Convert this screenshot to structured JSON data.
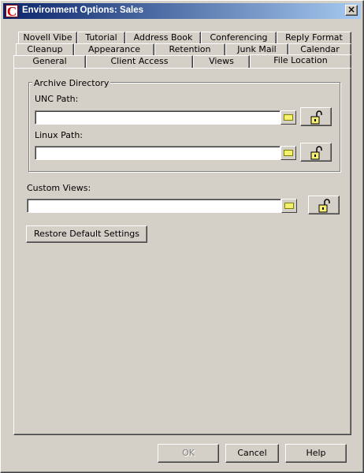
{
  "window": {
    "title": "Environment Options:  Sales",
    "icon_letter": "C",
    "close_label": "×"
  },
  "tabs": {
    "row1": [
      "Novell Vibe",
      "Tutorial",
      "Address Book",
      "Conferencing",
      "Reply Format"
    ],
    "row2": [
      "Cleanup",
      "Appearance",
      "Retention",
      "Junk Mail",
      "Calendar"
    ],
    "row3": [
      "General",
      "Client Access",
      "Views",
      "File Location"
    ],
    "active": "File Location"
  },
  "archive": {
    "group_label": "Archive Directory",
    "unc_label": "UNC Path:",
    "unc_value": "",
    "linux_label": "Linux Path:",
    "linux_value": ""
  },
  "custom_views": {
    "label": "Custom Views:",
    "value": ""
  },
  "restore_label": "Restore Default Settings",
  "footer": {
    "ok_label": "OK",
    "cancel_label": "Cancel",
    "help_label": "Help"
  },
  "icons": {
    "browse": "folder-icon",
    "lock": "unlock-icon",
    "app": "app-logo-icon"
  },
  "colors": {
    "titlebar_start": "#0a246a",
    "titlebar_end": "#a6caf0",
    "face": "#d4d0c8",
    "folder": "#f5f06e"
  }
}
